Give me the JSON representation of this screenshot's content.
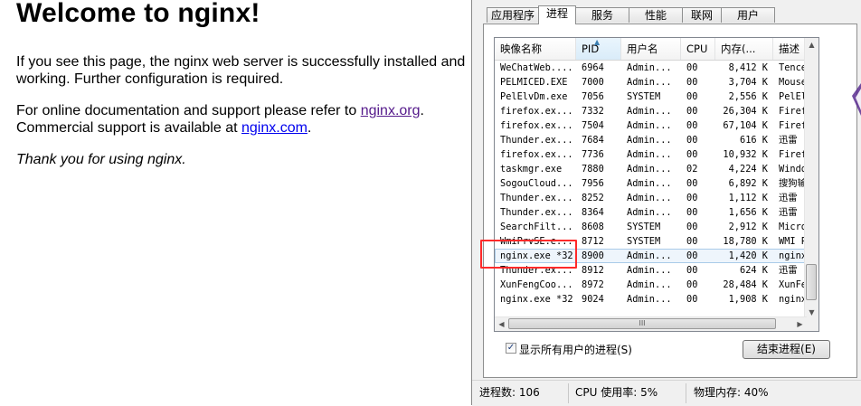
{
  "nginx": {
    "heading": "Welcome to nginx!",
    "p1": "If you see this page, the nginx web server is successfully installed and working. Further configuration is required.",
    "p2_before": "For online documentation and support please refer to ",
    "link1": "nginx.org",
    "p2_mid": ".",
    "p2_second": "Commercial support is available at ",
    "link2": "nginx.com",
    "p2_end": ".",
    "p3": "Thank you for using nginx."
  },
  "task_manager": {
    "tabs": [
      "应用程序",
      "进程",
      "服务",
      "性能",
      "联网",
      "用户"
    ],
    "active_tab": "进程",
    "columns": [
      "映像名称",
      "PID",
      "用户名",
      "CPU",
      "内存(...",
      "描述"
    ],
    "sorted_column": "PID",
    "rows": [
      [
        "WeChatWeb....",
        "6964",
        "Admin...",
        "00",
        "8,412 K",
        "Tencen"
      ],
      [
        "PELMICED.EXE",
        "7000",
        "Admin...",
        "00",
        "3,704 K",
        "Mouse"
      ],
      [
        "PelElvDm.exe",
        "7056",
        "SYSTEM",
        "00",
        "2,556 K",
        "PelElv"
      ],
      [
        "firefox.ex...",
        "7332",
        "Admin...",
        "00",
        "26,304 K",
        "Firefo"
      ],
      [
        "firefox.ex...",
        "7504",
        "Admin...",
        "00",
        "67,104 K",
        "Firefo"
      ],
      [
        "Thunder.ex...",
        "7684",
        "Admin...",
        "00",
        "616 K",
        "迅雷"
      ],
      [
        "firefox.ex...",
        "7736",
        "Admin...",
        "00",
        "10,932 K",
        "Firefo"
      ],
      [
        "taskmgr.exe",
        "7880",
        "Admin...",
        "02",
        "4,224 K",
        "Window"
      ],
      [
        "SogouCloud...",
        "7956",
        "Admin...",
        "00",
        "6,892 K",
        "搜狗输"
      ],
      [
        "Thunder.ex...",
        "8252",
        "Admin...",
        "00",
        "1,112 K",
        "迅雷"
      ],
      [
        "Thunder.ex...",
        "8364",
        "Admin...",
        "00",
        "1,656 K",
        "迅雷"
      ],
      [
        "SearchFilt...",
        "8608",
        "SYSTEM",
        "00",
        "2,912 K",
        "Micros"
      ],
      [
        "WmiPrvSE.e...",
        "8712",
        "SYSTEM",
        "00",
        "18,780 K",
        "WMI Pr"
      ],
      [
        "nginx.exe *32",
        "8900",
        "Admin...",
        "00",
        "1,420 K",
        "nginx."
      ],
      [
        "Thunder.ex...",
        "8912",
        "Admin...",
        "00",
        "624 K",
        "迅雷"
      ],
      [
        "XunFengCoo...",
        "8972",
        "Admin...",
        "00",
        "28,484 K",
        "XunFen"
      ],
      [
        "nginx.exe *32",
        "9024",
        "Admin...",
        "00",
        "1,908 K",
        "nginx."
      ]
    ],
    "selected_row": 13,
    "show_all_label": "显示所有用户的进程(S)",
    "show_all_checked": "✓",
    "end_process_label": "结束进程(E)",
    "hscroll_grip": "III",
    "status": {
      "processes": "进程数: 106",
      "cpu": "CPU 使用率: 5%",
      "memory": "物理内存: 40%"
    }
  },
  "colors": {
    "highlight_box": "#ff2a2a",
    "link_visited": "#551a8b",
    "link": "#0000ee",
    "edge_accent": "#5a2d91"
  }
}
